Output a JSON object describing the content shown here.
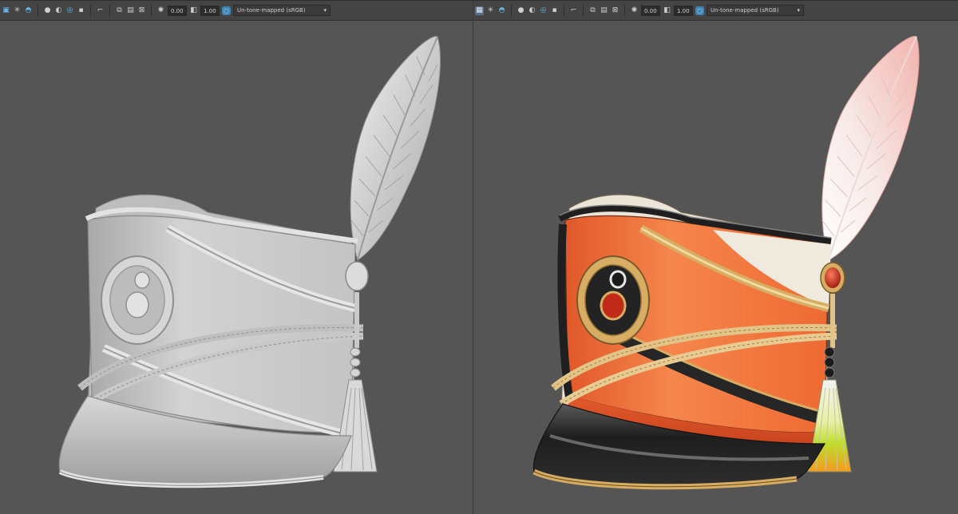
{
  "viewports": [
    {
      "name": "gray-model",
      "toolbar": {
        "exposure_value": "0.00",
        "gamma_value": "1.00",
        "color_mgmt": "Un-tone-mapped (sRGB)",
        "icons": [
          "camera-icon",
          "light-icon",
          "shading-icon",
          "sphere-icon",
          "material-icon",
          "isolate-icon",
          "frame-icon",
          "snapshot-icon",
          "grid-icon",
          "resolution-icon",
          "gear-icon",
          "gamma-icon",
          "color-management-icon",
          "dropdown-arrow-icon"
        ]
      }
    },
    {
      "name": "textured-model",
      "toolbar": {
        "exposure_value": "0.00",
        "gamma_value": "1.00",
        "color_mgmt": "Un-tone-mapped (sRGB)",
        "icons": [
          "wireframe-icon",
          "light-icon",
          "shading-icon",
          "sphere-icon",
          "material-icon",
          "isolate-icon",
          "frame-icon",
          "snapshot-icon",
          "grid-icon",
          "resolution-icon",
          "gear-icon",
          "gamma-icon",
          "color-management-icon",
          "dropdown-arrow-icon"
        ]
      }
    }
  ],
  "colors": {
    "viewport_bg": "#555555",
    "toolbar_bg": "#444444",
    "hat_orange": "#ee6a33",
    "hat_gold": "#d9b36a",
    "hat_black": "#242424",
    "hat_gray": "#c9c9c9"
  }
}
